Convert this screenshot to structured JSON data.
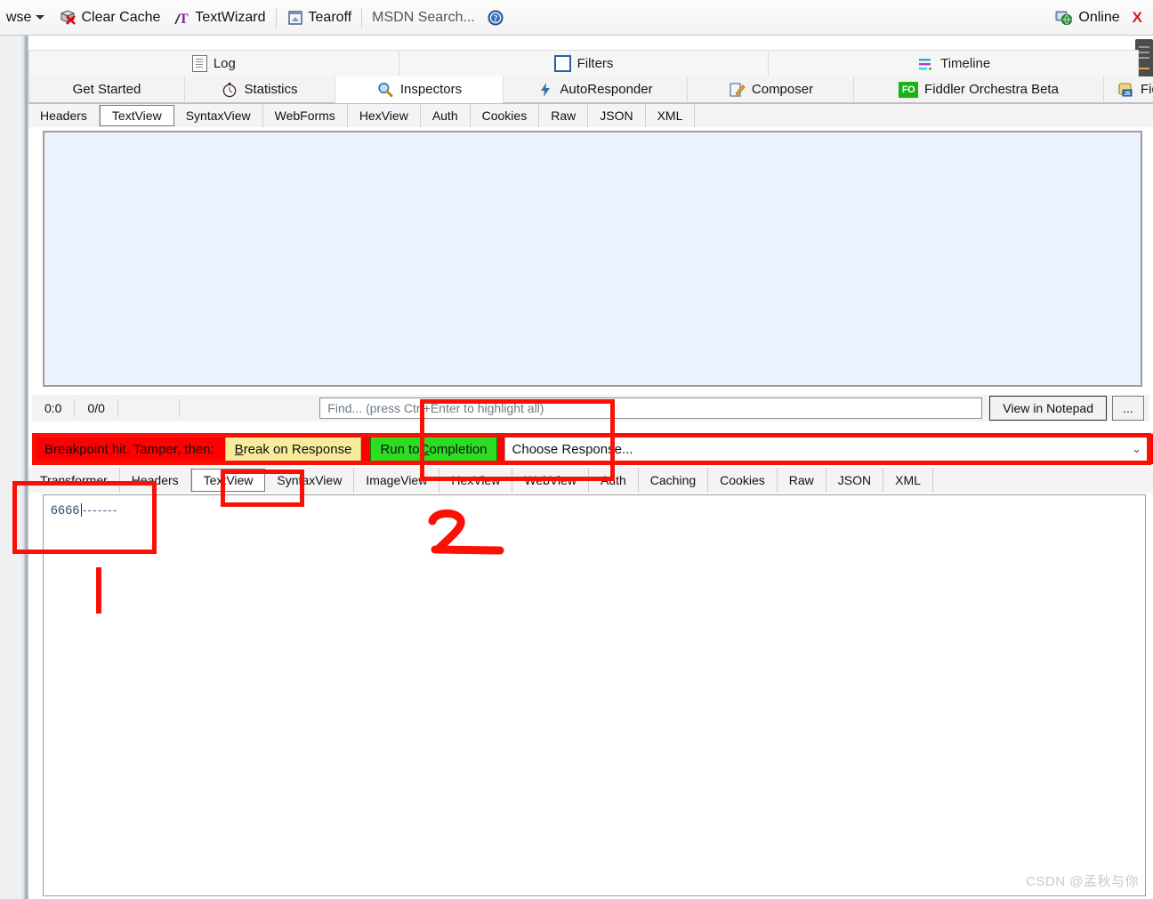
{
  "toolbar": {
    "browse_label": "wse",
    "clear_cache_label": "Clear Cache",
    "textwizard_label": "TextWizard",
    "tearoff_label": "Tearoff",
    "msdn_label": "MSDN Search...",
    "online_label": "Online",
    "close_label": "X"
  },
  "top_tabs": [
    {
      "label": "Log",
      "icon": "log-icon"
    },
    {
      "label": "Filters",
      "icon": "checkbox-icon"
    },
    {
      "label": "Timeline",
      "icon": "timeline-icon"
    }
  ],
  "main_tabs": [
    {
      "label": "Get Started",
      "icon": "",
      "selected": false
    },
    {
      "label": "Statistics",
      "icon": "stopwatch-icon",
      "selected": false
    },
    {
      "label": "Inspectors",
      "icon": "magnifier-icon",
      "selected": true
    },
    {
      "label": "AutoResponder",
      "icon": "lightning-icon",
      "selected": false
    },
    {
      "label": "Composer",
      "icon": "pencil-icon",
      "selected": false
    },
    {
      "label": "Fiddler Orchestra Beta",
      "icon": "fo-icon",
      "selected": false
    },
    {
      "label": "FiddlerScript",
      "icon": "script-icon",
      "selected": false
    }
  ],
  "request_tabs": [
    {
      "label": "Headers",
      "selected": false
    },
    {
      "label": "TextView",
      "selected": true
    },
    {
      "label": "SyntaxView",
      "selected": false
    },
    {
      "label": "WebForms",
      "selected": false
    },
    {
      "label": "HexView",
      "selected": false
    },
    {
      "label": "Auth",
      "selected": false
    },
    {
      "label": "Cookies",
      "selected": false
    },
    {
      "label": "Raw",
      "selected": false
    },
    {
      "label": "JSON",
      "selected": false
    },
    {
      "label": "XML",
      "selected": false
    }
  ],
  "request_body": {
    "content": ""
  },
  "findbar": {
    "position": "0:0",
    "matches": "0/0",
    "find_placeholder": "Find... (press Ctrl+Enter to highlight all)",
    "find_value": "",
    "view_in_notepad_label": "View in Notepad",
    "more_label": "..."
  },
  "breakpoint_bar": {
    "message": "Breakpoint hit. Tamper, then:",
    "break_on_response_label": "Break on Response",
    "break_on_response_accel": "B",
    "run_to_completion_label": "Run to Completion",
    "run_to_completion_accel": "C",
    "choose_response_label": "Choose Response...",
    "chevron": "⌄",
    "background_color": "#fe0000",
    "break_button_color": "#f7eb9c",
    "run_button_color": "#2ddd21"
  },
  "response_tabs": [
    {
      "label": "Transformer",
      "selected": false
    },
    {
      "label": "Headers",
      "selected": false
    },
    {
      "label": "TextView",
      "selected": true
    },
    {
      "label": "SyntaxView",
      "selected": false
    },
    {
      "label": "ImageView",
      "selected": false
    },
    {
      "label": "HexView",
      "selected": false
    },
    {
      "label": "WebView",
      "selected": false
    },
    {
      "label": "Auth",
      "selected": false
    },
    {
      "label": "Caching",
      "selected": false
    },
    {
      "label": "Cookies",
      "selected": false
    },
    {
      "label": "Raw",
      "selected": false
    },
    {
      "label": "JSON",
      "selected": false
    },
    {
      "label": "XML",
      "selected": false
    }
  ],
  "response_body": {
    "text": "6666",
    "trailing": "-------"
  },
  "annotations": {
    "marker_one": "1",
    "marker_two": "2",
    "color": "#fa1005"
  },
  "watermark": "CSDN @孟秋与你"
}
